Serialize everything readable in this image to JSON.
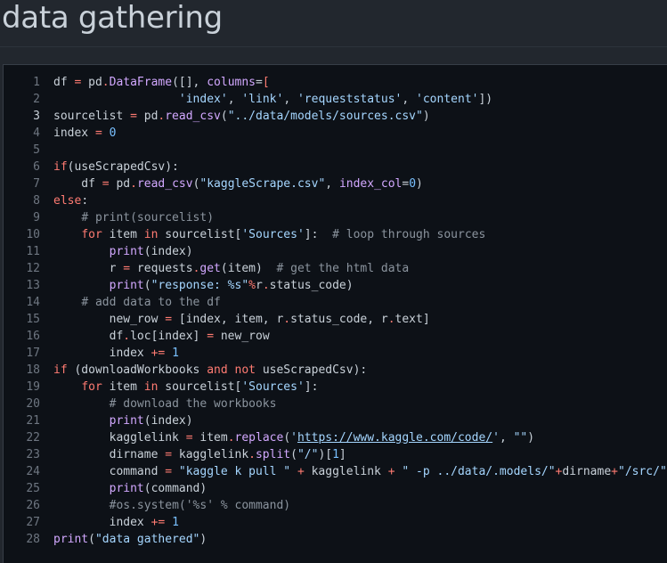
{
  "page": {
    "heading": "data gathering"
  },
  "code": {
    "active_line": 3,
    "lines": [
      [
        {
          "t": "df "
        },
        {
          "t": "=",
          "c": "k"
        },
        {
          "t": " pd"
        },
        {
          "t": ".",
          "c": "k"
        },
        {
          "t": "DataFrame",
          "c": "f"
        },
        {
          "t": "([], "
        },
        {
          "t": "columns",
          "c": "f"
        },
        {
          "t": "="
        },
        {
          "t": "[",
          "c": "k"
        }
      ],
      [
        {
          "t": "                  "
        },
        {
          "t": "'index'",
          "c": "s"
        },
        {
          "t": ", "
        },
        {
          "t": "'link'",
          "c": "s"
        },
        {
          "t": ", "
        },
        {
          "t": "'requeststatus'",
          "c": "s"
        },
        {
          "t": ", "
        },
        {
          "t": "'content'",
          "c": "s"
        },
        {
          "t": "])"
        }
      ],
      [
        {
          "t": "sourcelist "
        },
        {
          "t": "=",
          "c": "k"
        },
        {
          "t": " pd"
        },
        {
          "t": ".",
          "c": "k"
        },
        {
          "t": "read_csv",
          "c": "f"
        },
        {
          "t": "("
        },
        {
          "t": "\"../data/models/sources.csv\"",
          "c": "s"
        },
        {
          "t": ")"
        }
      ],
      [
        {
          "t": "index "
        },
        {
          "t": "=",
          "c": "k"
        },
        {
          "t": " "
        },
        {
          "t": "0",
          "c": "n"
        }
      ],
      [
        {
          "t": ""
        }
      ],
      [
        {
          "t": "if",
          "c": "k"
        },
        {
          "t": "(useScrapedCsv):"
        }
      ],
      [
        {
          "t": "    df "
        },
        {
          "t": "=",
          "c": "k"
        },
        {
          "t": " pd"
        },
        {
          "t": ".",
          "c": "k"
        },
        {
          "t": "read_csv",
          "c": "f"
        },
        {
          "t": "("
        },
        {
          "t": "\"kaggleScrape.csv\"",
          "c": "s"
        },
        {
          "t": ", "
        },
        {
          "t": "index_col",
          "c": "f"
        },
        {
          "t": "="
        },
        {
          "t": "0",
          "c": "n"
        },
        {
          "t": ")"
        }
      ],
      [
        {
          "t": "else",
          "c": "k"
        },
        {
          "t": ":"
        }
      ],
      [
        {
          "t": "    "
        },
        {
          "t": "# print(sourcelist)",
          "c": "c"
        }
      ],
      [
        {
          "t": "    "
        },
        {
          "t": "for",
          "c": "k"
        },
        {
          "t": " item "
        },
        {
          "t": "in",
          "c": "k"
        },
        {
          "t": " sourcelist["
        },
        {
          "t": "'Sources'",
          "c": "s"
        },
        {
          "t": "]:  "
        },
        {
          "t": "# loop through sources",
          "c": "c"
        }
      ],
      [
        {
          "t": "        "
        },
        {
          "t": "print",
          "c": "f"
        },
        {
          "t": "(index)"
        }
      ],
      [
        {
          "t": "        r "
        },
        {
          "t": "=",
          "c": "k"
        },
        {
          "t": " requests"
        },
        {
          "t": ".",
          "c": "k"
        },
        {
          "t": "get",
          "c": "f"
        },
        {
          "t": "(item)  "
        },
        {
          "t": "# get the html data",
          "c": "c"
        }
      ],
      [
        {
          "t": "        "
        },
        {
          "t": "print",
          "c": "f"
        },
        {
          "t": "("
        },
        {
          "t": "\"response: %s\"",
          "c": "s"
        },
        {
          "t": "%",
          "c": "k"
        },
        {
          "t": "r"
        },
        {
          "t": ".",
          "c": "k"
        },
        {
          "t": "status_code)"
        }
      ],
      [
        {
          "t": "    "
        },
        {
          "t": "# add data to the df",
          "c": "c"
        }
      ],
      [
        {
          "t": "        new_row "
        },
        {
          "t": "=",
          "c": "k"
        },
        {
          "t": " [index, item, r"
        },
        {
          "t": ".",
          "c": "k"
        },
        {
          "t": "status_code, r"
        },
        {
          "t": ".",
          "c": "k"
        },
        {
          "t": "text]"
        }
      ],
      [
        {
          "t": "        df"
        },
        {
          "t": ".",
          "c": "k"
        },
        {
          "t": "loc[index] "
        },
        {
          "t": "=",
          "c": "k"
        },
        {
          "t": " new_row"
        }
      ],
      [
        {
          "t": "        index "
        },
        {
          "t": "+=",
          "c": "k"
        },
        {
          "t": " "
        },
        {
          "t": "1",
          "c": "n"
        }
      ],
      [
        {
          "t": "if",
          "c": "k"
        },
        {
          "t": " (downloadWorkbooks "
        },
        {
          "t": "and",
          "c": "k"
        },
        {
          "t": " "
        },
        {
          "t": "not",
          "c": "k"
        },
        {
          "t": " useScrapedCsv):"
        }
      ],
      [
        {
          "t": "    "
        },
        {
          "t": "for",
          "c": "k"
        },
        {
          "t": " item "
        },
        {
          "t": "in",
          "c": "k"
        },
        {
          "t": " sourcelist["
        },
        {
          "t": "'Sources'",
          "c": "s"
        },
        {
          "t": "]:"
        }
      ],
      [
        {
          "t": "        "
        },
        {
          "t": "# download the workbooks",
          "c": "c"
        }
      ],
      [
        {
          "t": "        "
        },
        {
          "t": "print",
          "c": "f"
        },
        {
          "t": "(index)"
        }
      ],
      [
        {
          "t": "        kagglelink "
        },
        {
          "t": "=",
          "c": "k"
        },
        {
          "t": " item"
        },
        {
          "t": ".",
          "c": "k"
        },
        {
          "t": "replace",
          "c": "f"
        },
        {
          "t": "("
        },
        {
          "t": "'",
          "c": "s"
        },
        {
          "t": "https://www.kaggle.com/code/",
          "c": "s u"
        },
        {
          "t": "'",
          "c": "s"
        },
        {
          "t": ", "
        },
        {
          "t": "\"\"",
          "c": "s"
        },
        {
          "t": ")"
        }
      ],
      [
        {
          "t": "        dirname "
        },
        {
          "t": "=",
          "c": "k"
        },
        {
          "t": " kagglelink"
        },
        {
          "t": ".",
          "c": "k"
        },
        {
          "t": "split",
          "c": "f"
        },
        {
          "t": "("
        },
        {
          "t": "\"/\"",
          "c": "s"
        },
        {
          "t": ")["
        },
        {
          "t": "1",
          "c": "n"
        },
        {
          "t": "]"
        }
      ],
      [
        {
          "t": "        command "
        },
        {
          "t": "=",
          "c": "k"
        },
        {
          "t": " "
        },
        {
          "t": "\"kaggle k pull \"",
          "c": "s"
        },
        {
          "t": " "
        },
        {
          "t": "+",
          "c": "k"
        },
        {
          "t": " kagglelink "
        },
        {
          "t": "+",
          "c": "k"
        },
        {
          "t": " "
        },
        {
          "t": "\" -p ../data/.models/\"",
          "c": "s"
        },
        {
          "t": "+",
          "c": "k"
        },
        {
          "t": "dirname"
        },
        {
          "t": "+",
          "c": "k"
        },
        {
          "t": "\"/src/\"",
          "c": "s"
        }
      ],
      [
        {
          "t": "        "
        },
        {
          "t": "print",
          "c": "f"
        },
        {
          "t": "(command)"
        }
      ],
      [
        {
          "t": "        "
        },
        {
          "t": "#os.system('%s' % command)",
          "c": "c"
        }
      ],
      [
        {
          "t": "        index "
        },
        {
          "t": "+=",
          "c": "k"
        },
        {
          "t": " "
        },
        {
          "t": "1",
          "c": "n"
        }
      ],
      [
        {
          "t": "print",
          "c": "f"
        },
        {
          "t": "("
        },
        {
          "t": "\"data gathered\"",
          "c": "s"
        },
        {
          "t": ")"
        }
      ]
    ]
  }
}
